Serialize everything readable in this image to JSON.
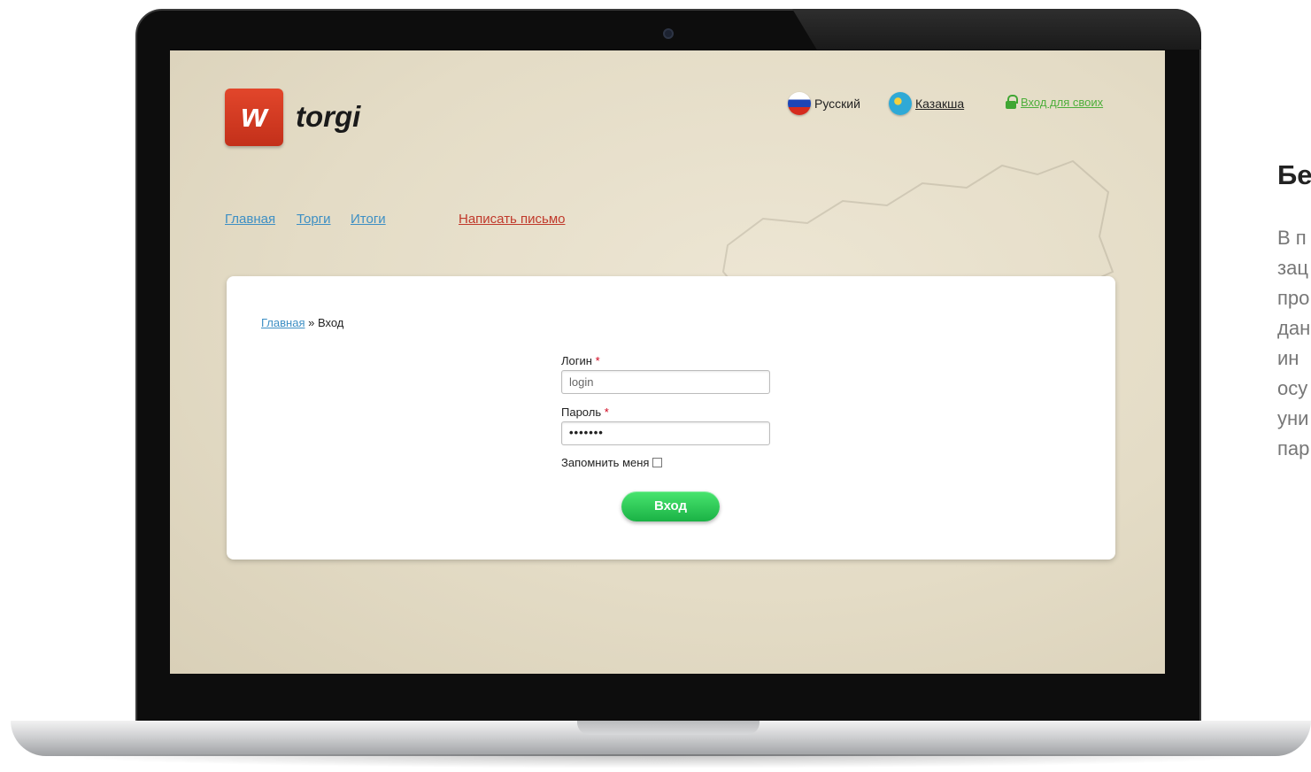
{
  "site": {
    "logo_letter": "w",
    "logo_text": "torgi",
    "lang_ru": "Русский",
    "lang_kz": "Казакша",
    "login_link": "Вход для своих",
    "nav": {
      "home": "Главная",
      "torgi": "Торги",
      "itogi": "Итоги",
      "write": "Написать письмо"
    },
    "breadcrumb": {
      "home": "Главная",
      "separator": " » ",
      "current": "Вход"
    },
    "form": {
      "login_label": "Логин",
      "login_value": "login",
      "password_label": "Пароль",
      "password_value": "•••••••",
      "required_mark": " *",
      "remember_label": "Запомнить меня",
      "submit_label": "Вход"
    }
  },
  "side": {
    "title": "Бе",
    "lines": [
      "В п",
      "зац",
      "про",
      "дан",
      "ин",
      "осу",
      "уни",
      "пар"
    ]
  },
  "colors": {
    "brand_red": "#d43a22",
    "link_blue": "#3d8fc4",
    "accent_green": "#1ab245",
    "link_red": "#c0392b"
  },
  "icons": [
    "camera-icon",
    "russia-flag-icon",
    "kazakhstan-flag-icon",
    "lock-icon",
    "checkbox-icon"
  ]
}
